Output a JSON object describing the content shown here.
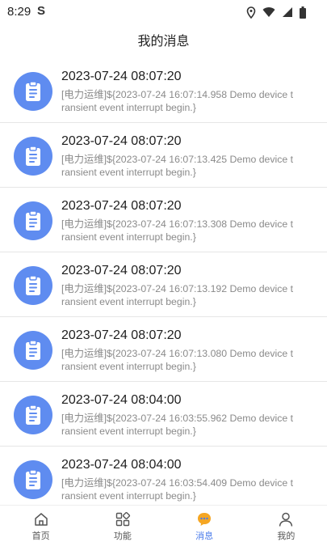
{
  "status_bar": {
    "time": "8:29",
    "notification": "S"
  },
  "header": {
    "title": "我的消息"
  },
  "messages": [
    {
      "title": "2023-07-24 08:07:20",
      "text": "[电力运维]${2023-07-24 16:07:14.958 Demo device transient event interrupt begin.}"
    },
    {
      "title": "2023-07-24 08:07:20",
      "text": "[电力运维]${2023-07-24 16:07:13.425 Demo device transient event interrupt begin.}"
    },
    {
      "title": "2023-07-24 08:07:20",
      "text": "[电力运维]${2023-07-24 16:07:13.308 Demo device transient event interrupt begin.}"
    },
    {
      "title": "2023-07-24 08:07:20",
      "text": "[电力运维]${2023-07-24 16:07:13.192 Demo device transient event interrupt begin.}"
    },
    {
      "title": "2023-07-24 08:07:20",
      "text": "[电力运维]${2023-07-24 16:07:13.080 Demo device transient event interrupt begin.}"
    },
    {
      "title": "2023-07-24 08:04:00",
      "text": "[电力运维]${2023-07-24 16:03:55.962 Demo device transient event interrupt begin.}"
    },
    {
      "title": "2023-07-24 08:04:00",
      "text": "[电力运维]${2023-07-24 16:03:54.409 Demo device transient event interrupt begin.}"
    }
  ],
  "tabbar": {
    "items": [
      {
        "label": "首页",
        "icon": "home-icon"
      },
      {
        "label": "功能",
        "icon": "grid-icon"
      },
      {
        "label": "消息",
        "icon": "message-icon",
        "active": true
      },
      {
        "label": "我的",
        "icon": "user-icon"
      }
    ]
  },
  "colors": {
    "accent": "#4a7bea",
    "avatar": "#5f8cf0",
    "divider": "#e6e6e6"
  }
}
